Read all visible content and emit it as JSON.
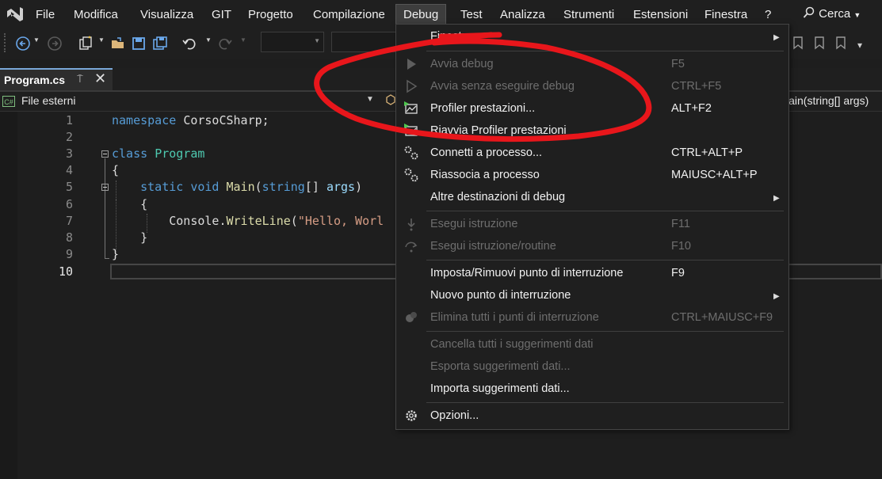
{
  "menubar": {
    "items": [
      "File",
      "Modifica",
      "Visualizza",
      "GIT",
      "Progetto",
      "Compilazione",
      "Debug",
      "Test",
      "Analizza",
      "Strumenti",
      "Estensioni",
      "Finestra",
      "?"
    ],
    "search": "Cerca"
  },
  "tab": {
    "label": "Program.cs",
    "pin": "⍑",
    "close": "✕"
  },
  "navbar": {
    "file_scope": "File esterni",
    "member": "lain(string[] args)",
    "lang_badge": "C#"
  },
  "editor": {
    "line_numbers": [
      "1",
      "2",
      "3",
      "4",
      "5",
      "6",
      "7",
      "8",
      "9",
      "10"
    ],
    "lines": [
      {
        "tokens": [
          {
            "t": "namespace ",
            "c": "kw"
          },
          {
            "t": "CorsoCSharp;",
            "c": ""
          }
        ]
      },
      {
        "tokens": []
      },
      {
        "tokens": [
          {
            "t": "class ",
            "c": "kw"
          },
          {
            "t": "Program",
            "c": "ty"
          }
        ]
      },
      {
        "tokens": [
          {
            "t": "{",
            "c": ""
          }
        ]
      },
      {
        "tokens": [
          {
            "t": "    static void ",
            "c": "kw"
          },
          {
            "t": "Main",
            "c": "mt"
          },
          {
            "t": "(",
            "c": ""
          },
          {
            "t": "string",
            "c": "kw"
          },
          {
            "t": "[] ",
            "c": ""
          },
          {
            "t": "args",
            "c": "pm"
          },
          {
            "t": ")",
            "c": ""
          }
        ]
      },
      {
        "tokens": [
          {
            "t": "    {",
            "c": ""
          }
        ]
      },
      {
        "tokens": [
          {
            "t": "        Console.",
            "c": ""
          },
          {
            "t": "WriteLine",
            "c": "mt"
          },
          {
            "t": "(",
            "c": ""
          },
          {
            "t": "\"Hello, Worl",
            "c": "st"
          }
        ]
      },
      {
        "tokens": [
          {
            "t": "    }",
            "c": ""
          }
        ]
      },
      {
        "tokens": [
          {
            "t": "}",
            "c": ""
          }
        ]
      },
      {
        "tokens": []
      }
    ]
  },
  "debug_menu": {
    "top_item": "Finestre",
    "items": [
      {
        "label": "Avvia debug",
        "shortcut": "F5",
        "disabled": true,
        "icon": "play-icon"
      },
      {
        "label": "Avvia senza eseguire debug",
        "shortcut": "CTRL+F5",
        "disabled": true,
        "icon": "play-outline-icon"
      },
      {
        "label": "Profiler prestazioni...",
        "shortcut": "ALT+F2",
        "disabled": false,
        "icon": "profiler-icon"
      },
      {
        "label": "Riavvia Profiler prestazioni",
        "shortcut": "",
        "disabled": false,
        "icon": "profiler-restart-icon"
      },
      {
        "label": "Connetti a processo...",
        "shortcut": "CTRL+ALT+P",
        "disabled": false,
        "icon": "gears-icon"
      },
      {
        "label": "Riassocia a processo",
        "shortcut": "MAIUSC+ALT+P",
        "disabled": false,
        "icon": "gears-icon"
      },
      {
        "label": "Altre destinazioni di debug",
        "shortcut": "",
        "disabled": false,
        "submenu": true
      },
      {
        "label": "Esegui istruzione",
        "shortcut": "F11",
        "disabled": true,
        "icon": "step-into-icon"
      },
      {
        "label": "Esegui istruzione/routine",
        "shortcut": "F10",
        "disabled": true,
        "icon": "step-over-icon"
      },
      {
        "label": "Imposta/Rimuovi punto di interruzione",
        "shortcut": "F9",
        "disabled": false
      },
      {
        "label": "Nuovo punto di interruzione",
        "shortcut": "",
        "disabled": false,
        "submenu": true
      },
      {
        "label": "Elimina tutti i punti di interruzione",
        "shortcut": "CTRL+MAIUSC+F9",
        "disabled": true,
        "icon": "breakpoints-delete-icon"
      },
      {
        "label": "Cancella tutti i suggerimenti dati",
        "shortcut": "",
        "disabled": true
      },
      {
        "label": "Esporta suggerimenti dati...",
        "shortcut": "",
        "disabled": true
      },
      {
        "label": "Importa suggerimenti dati...",
        "shortcut": "",
        "disabled": false
      },
      {
        "label": "Opzioni...",
        "shortcut": "",
        "disabled": false,
        "icon": "gear-icon"
      }
    ]
  },
  "annotation": {
    "color": "#e8161b"
  },
  "colors": {
    "accent": "#7aa8d8",
    "keyword": "#569cd6",
    "type": "#4ec9b0",
    "method": "#dcdcaa",
    "string": "#d69d85"
  }
}
